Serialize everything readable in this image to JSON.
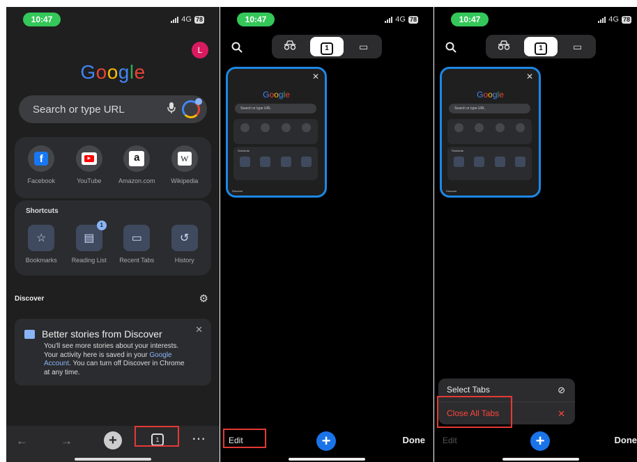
{
  "status": {
    "time": "10:47",
    "network": "4G",
    "battery": "78"
  },
  "ntp": {
    "avatar_initial": "L",
    "logo": [
      {
        "ch": "G",
        "color": "#4285f4"
      },
      {
        "ch": "o",
        "color": "#ea4335"
      },
      {
        "ch": "o",
        "color": "#fbbc05"
      },
      {
        "ch": "g",
        "color": "#4285f4"
      },
      {
        "ch": "l",
        "color": "#34a853"
      },
      {
        "ch": "e",
        "color": "#ea4335"
      }
    ],
    "search_placeholder": "Search or type URL",
    "most_visited": [
      {
        "label": "Facebook",
        "icon": "facebook-icon",
        "glyph": "f"
      },
      {
        "label": "YouTube",
        "icon": "youtube-icon",
        "glyph": "▶"
      },
      {
        "label": "Amazon.com",
        "icon": "amazon-icon",
        "glyph": "a"
      },
      {
        "label": "Wikipedia",
        "icon": "wikipedia-icon",
        "glyph": "W"
      }
    ],
    "shortcuts_title": "Shortcuts",
    "shortcuts": [
      {
        "label": "Bookmarks",
        "icon": "star-icon",
        "glyph": "☆"
      },
      {
        "label": "Reading List",
        "icon": "reading-list-icon",
        "glyph": "▤",
        "badge": "1"
      },
      {
        "label": "Recent Tabs",
        "icon": "devices-icon",
        "glyph": "▭"
      },
      {
        "label": "History",
        "icon": "history-icon",
        "glyph": "↺"
      }
    ],
    "discover_label": "Discover",
    "discover_card": {
      "title": "Better stories from Discover",
      "body_1": "You'll see more stories about your interests. Your activity here is saved in your ",
      "link": "Google Account",
      "body_2": ". You can turn off Discover in Chrome at any time."
    },
    "toolbar": {
      "tab_count": "1"
    }
  },
  "switcher": {
    "active_tab_count": "1",
    "thumbnail": {
      "logo": "Google",
      "search": "Search or type URL",
      "shortcuts_title": "Shortcuts",
      "discover": "Discover"
    },
    "edit_label": "Edit",
    "done_label": "Done",
    "menu": {
      "select_tabs": "Select Tabs",
      "close_all_tabs": "Close All Tabs"
    }
  },
  "colors": {
    "highlight": "#e53935",
    "accent_blue": "#1a73e8",
    "danger": "#ff453a"
  }
}
